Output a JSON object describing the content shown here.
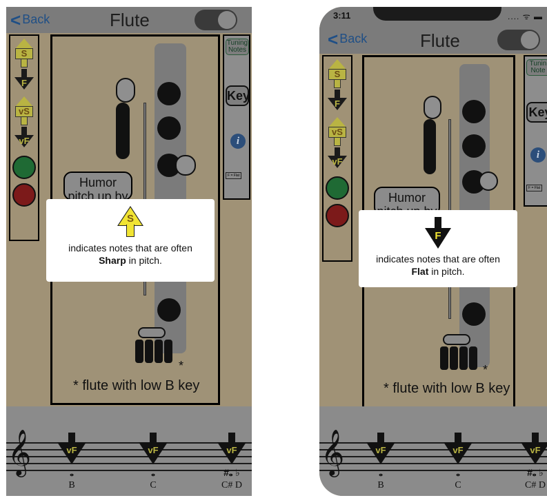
{
  "status_bar": {
    "time": "3:11",
    "icons": ".... ᯤ ▬"
  },
  "nav": {
    "back_label": "Back",
    "title": "Flute",
    "back_chevron": "<"
  },
  "rail": {
    "sharp_label": "S",
    "flat_label": "F",
    "very_sharp_label": "vS",
    "very_flat_label": "vF",
    "colors": {
      "green": "#1f6a34",
      "red": "#7c1a1a",
      "arrow_yellow": "#b9b443"
    }
  },
  "side": {
    "tuning_notes_label": "Tuning Notes",
    "tuning_notes_label_cropped": "Tunin Note",
    "key_label": "Key",
    "key_label_cropped": "Key",
    "info_label": "i",
    "legend_label": "F = Flat"
  },
  "instrument": {
    "pill_text": "Humor pitch up by",
    "footnote_star": "*",
    "footnote_text": "* flute with low B key"
  },
  "popups": {
    "left": {
      "symbol": "S",
      "line1": "indicates notes that are often",
      "bold": "Sharp",
      "line2_rest": " in pitch."
    },
    "right": {
      "symbol": "F",
      "line1": "indicates notes that are often",
      "bold": "Flat",
      "line2_rest": " in pitch."
    }
  },
  "staff": {
    "clef": "𝄞",
    "notes_left": [
      {
        "arrow": "vF",
        "head": "𝅝",
        "name": "B"
      },
      {
        "arrow": "vF",
        "head": "𝅝",
        "name": "C"
      },
      {
        "arrow": "vF",
        "head": "#𝅝 ♭",
        "name": "C#  D"
      }
    ],
    "notes_right": [
      {
        "arrow": "vF",
        "head": "𝅝",
        "name": "B"
      },
      {
        "arrow": "vF",
        "head": "𝅝",
        "name": "C"
      },
      {
        "arrow": "vF",
        "head": "#𝅝 ♭",
        "name": "C#  D"
      }
    ]
  }
}
